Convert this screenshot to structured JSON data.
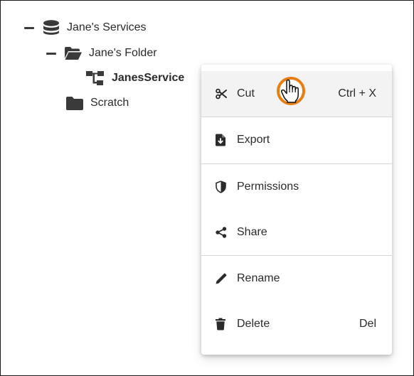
{
  "tree": {
    "root": {
      "label": "Jane's Services",
      "icon": "database-icon",
      "expanded": true
    },
    "folder": {
      "label": "Jane's Folder",
      "icon": "folder-open-icon",
      "expanded": true
    },
    "service": {
      "label": "JanesService",
      "icon": "service-tree-icon"
    },
    "scratch": {
      "label": "Scratch",
      "icon": "folder-icon"
    }
  },
  "context_menu": {
    "items": [
      {
        "label": "Cut",
        "icon": "scissors-icon",
        "shortcut": "Ctrl + X"
      },
      {
        "label": "Export",
        "icon": "file-export-icon",
        "shortcut": ""
      },
      {
        "label": "Permissions",
        "icon": "shield-icon",
        "shortcut": ""
      },
      {
        "label": "Share",
        "icon": "share-icon",
        "shortcut": ""
      },
      {
        "label": "Rename",
        "icon": "pencil-icon",
        "shortcut": ""
      },
      {
        "label": "Delete",
        "icon": "trash-icon",
        "shortcut": "Del"
      }
    ]
  },
  "cursor": {
    "icon": "hand-pointer-icon",
    "ring_color": "#e87d12"
  },
  "colors": {
    "text": "#2b2b2b",
    "icon": "#3a3a3a",
    "hover": "#f3f3f3",
    "divider": "#d6d6d6"
  }
}
